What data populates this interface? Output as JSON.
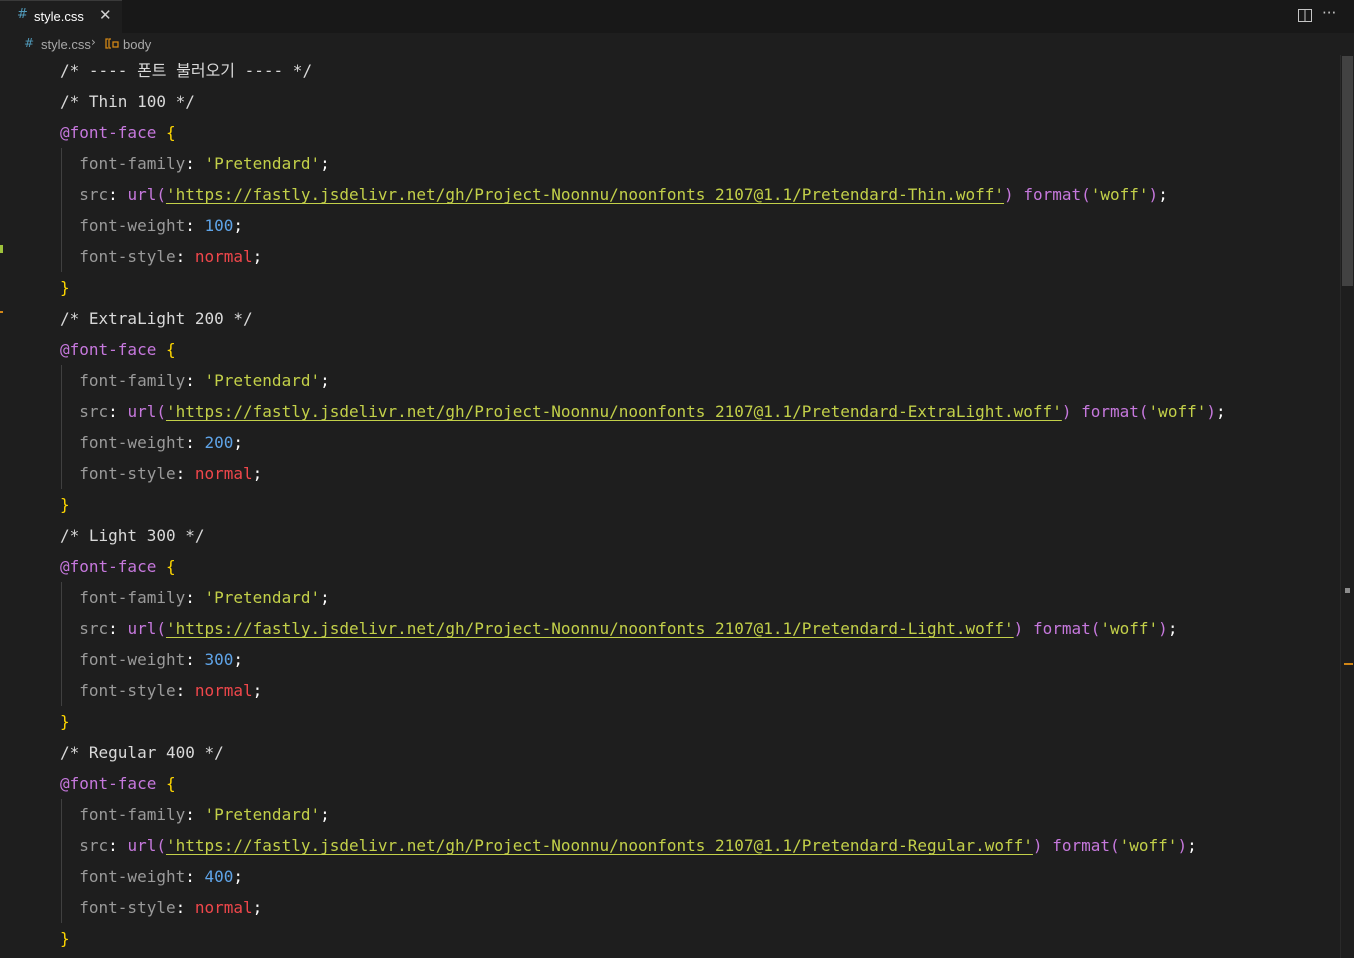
{
  "tab": {
    "icon": "#",
    "filename": "style.css",
    "close": "✕"
  },
  "actions": {
    "more": "···"
  },
  "breadcrumb": {
    "icon": "#",
    "file": "style.css",
    "separator": "›",
    "symbol": "body"
  },
  "code": {
    "header_comment": "/* ---- 폰트 불러오기 ---- */",
    "blocks": [
      {
        "comment": "/* Thin 100 */",
        "at_rule": "@font-face",
        "open": "{",
        "family_prop": "font-family",
        "family_value": "'Pretendard'",
        "src_prop": "src",
        "url_func": "url(",
        "url_value": "'https://fastly.jsdelivr.net/gh/Project-Noonnu/noonfonts_2107@1.1/Pretendard-Thin.woff'",
        "close_paren": ")",
        "format_func": "format(",
        "format_value": "'woff'",
        "format_close": ")",
        "weight_prop": "font-weight",
        "weight_value": "100",
        "style_prop": "font-style",
        "style_value": "normal",
        "close": "}"
      },
      {
        "comment": "/* ExtraLight 200 */",
        "at_rule": "@font-face",
        "open": "{",
        "family_prop": "font-family",
        "family_value": "'Pretendard'",
        "src_prop": "src",
        "url_func": "url(",
        "url_value": "'https://fastly.jsdelivr.net/gh/Project-Noonnu/noonfonts_2107@1.1/Pretendard-ExtraLight.woff'",
        "close_paren": ")",
        "format_func": "format(",
        "format_value": "'woff'",
        "format_close": ")",
        "weight_prop": "font-weight",
        "weight_value": "200",
        "style_prop": "font-style",
        "style_value": "normal",
        "close": "}"
      },
      {
        "comment": "/* Light 300 */",
        "at_rule": "@font-face",
        "open": "{",
        "family_prop": "font-family",
        "family_value": "'Pretendard'",
        "src_prop": "src",
        "url_func": "url(",
        "url_value": "'https://fastly.jsdelivr.net/gh/Project-Noonnu/noonfonts_2107@1.1/Pretendard-Light.woff'",
        "close_paren": ")",
        "format_func": "format(",
        "format_value": "'woff'",
        "format_close": ")",
        "weight_prop": "font-weight",
        "weight_value": "300",
        "style_prop": "font-style",
        "style_value": "normal",
        "close": "}"
      },
      {
        "comment": "/* Regular 400 */",
        "at_rule": "@font-face",
        "open": "{",
        "family_prop": "font-family",
        "family_value": "'Pretendard'",
        "src_prop": "src",
        "url_func": "url(",
        "url_value": "'https://fastly.jsdelivr.net/gh/Project-Noonnu/noonfonts_2107@1.1/Pretendard-Regular.woff'",
        "close_paren": ")",
        "format_func": "format(",
        "format_value": "'woff'",
        "format_close": ")",
        "weight_prop": "font-weight",
        "weight_value": "400",
        "style_prop": "font-style",
        "style_value": "normal",
        "close": "}"
      }
    ]
  },
  "colors": {
    "background": "#1e1e1e",
    "tabbar": "#181818",
    "comment": "#d9d9d9",
    "at_rule": "#c678dd",
    "brace": "#ffd700",
    "property": "#9a9a9a",
    "string": "#c3d049",
    "number": "#5fa4e8",
    "keyword": "#f0474b",
    "css_icon": "#519aba"
  },
  "icons": {
    "file_icon": "css-hash-icon",
    "close_icon": "close-icon",
    "split_icon": "split-editor-icon",
    "more_icon": "more-actions-icon",
    "symbol_icon": "css-selector-icon"
  }
}
